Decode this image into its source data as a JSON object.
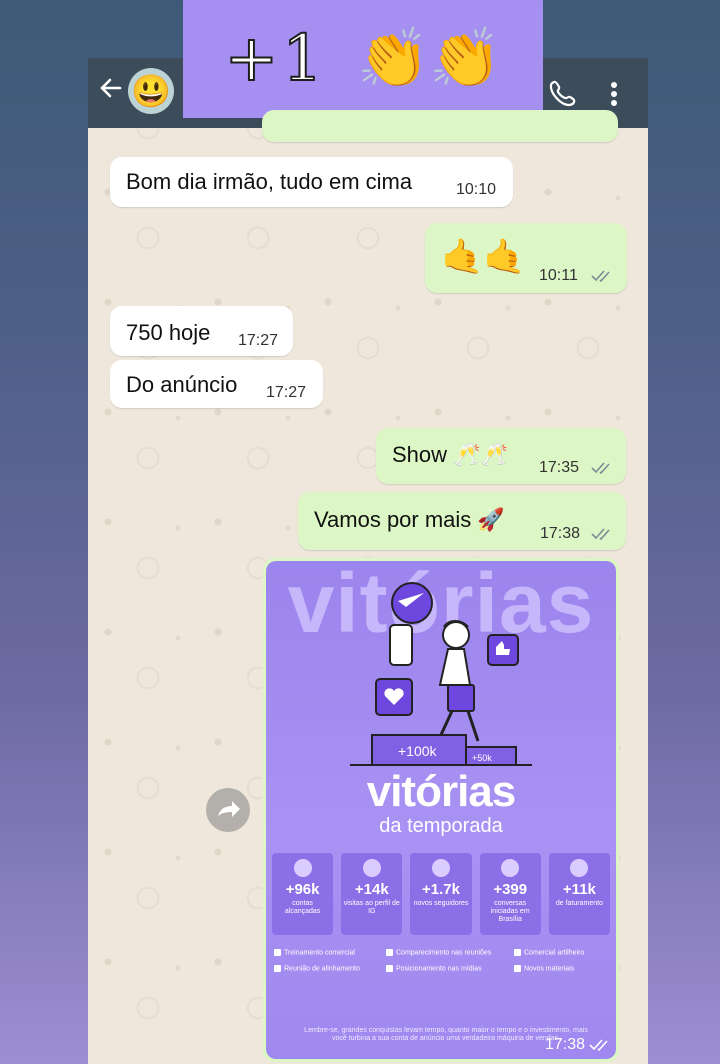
{
  "banner": {
    "plus_one": "+1",
    "claps": "👏👏"
  },
  "header": {
    "back_icon": "back-arrow-icon",
    "avatar_emoji": "😃",
    "call_icon": "phone-icon",
    "menu_icon": "more-vert-icon"
  },
  "messages": [
    {
      "dir": "in",
      "text": "Bom dia irmão, tudo em cima",
      "time": "10:10"
    },
    {
      "dir": "out",
      "text": "🤙🤙",
      "time": "10:11"
    },
    {
      "dir": "in",
      "text": "750 hoje",
      "time": "17:27"
    },
    {
      "dir": "in",
      "text": "Do anúncio",
      "time": "17:27"
    },
    {
      "dir": "out",
      "text": "Show 🥂🥂",
      "time": "17:35"
    },
    {
      "dir": "out",
      "text": "Vamos por mais 🚀",
      "time": "17:38"
    }
  ],
  "image_message": {
    "big_word": "vitórias",
    "title": "vitórias",
    "subtitle": "da temporada",
    "podium": {
      "first": "+100k",
      "second": "+50k"
    },
    "stats": [
      {
        "value": "+96k",
        "label": "contas alcançadas"
      },
      {
        "value": "+14k",
        "label": "visitas ao perfil de IG"
      },
      {
        "value": "+1.7k",
        "label": "novos seguidores"
      },
      {
        "value": "+399",
        "label": "conversas iniciadas em Brasília"
      },
      {
        "value": "+11k",
        "label": "de faturamento"
      }
    ],
    "checklist": [
      "Treinamento comercial",
      "Comparecimento nas reuniões",
      "Comercial artilheiro",
      "Reunião de alinhamento",
      "Posicionamento nas mídias",
      "Novos materiais"
    ],
    "footer": "Lembre-se, grandes conquistas levam tempo, quanto maior o tempo e o investimento, mais você turbina a sua conta de anúncio uma verdadeira máquina de vendas.",
    "time": "17:38"
  }
}
